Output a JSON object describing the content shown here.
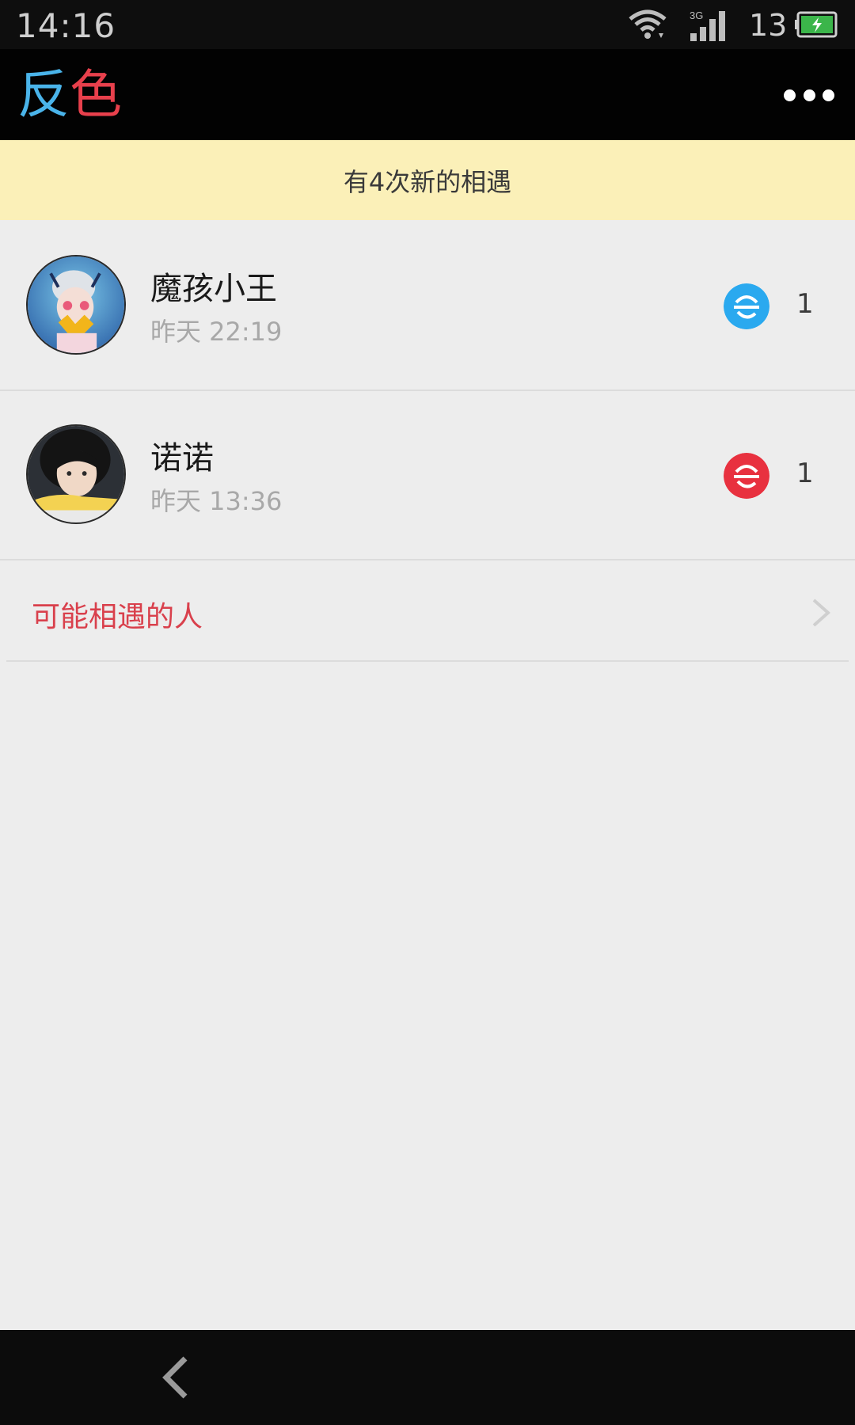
{
  "status_bar": {
    "time": "14:16",
    "network_type": "3G",
    "battery_level": "13",
    "icons": [
      "wifi-icon",
      "signal-icon",
      "battery-icon"
    ]
  },
  "title_bar": {
    "logo_part1": "反",
    "logo_part2": "色",
    "more_icon": "more-dots-icon"
  },
  "notice": {
    "text": "有4次新的相遇"
  },
  "encounters": [
    {
      "name": "魔孩小王",
      "time": "昨天 22:19",
      "count": "1",
      "badge_color": "#2aa9ef",
      "badge_icon": "encounter-badge-icon"
    },
    {
      "name": "诺诺",
      "time": "昨天 13:36",
      "count": "1",
      "badge_color": "#e8313f",
      "badge_icon": "encounter-badge-icon"
    }
  ],
  "maybe_met": {
    "label": "可能相遇的人",
    "icon": "chevron-right-icon"
  },
  "nav_bar": {
    "icon": "back-icon"
  },
  "colors": {
    "accent_blue": "#4ab4ea",
    "accent_red": "#e8404c",
    "notice_bg": "#fbf0b8",
    "list_bg": "#ededed"
  }
}
